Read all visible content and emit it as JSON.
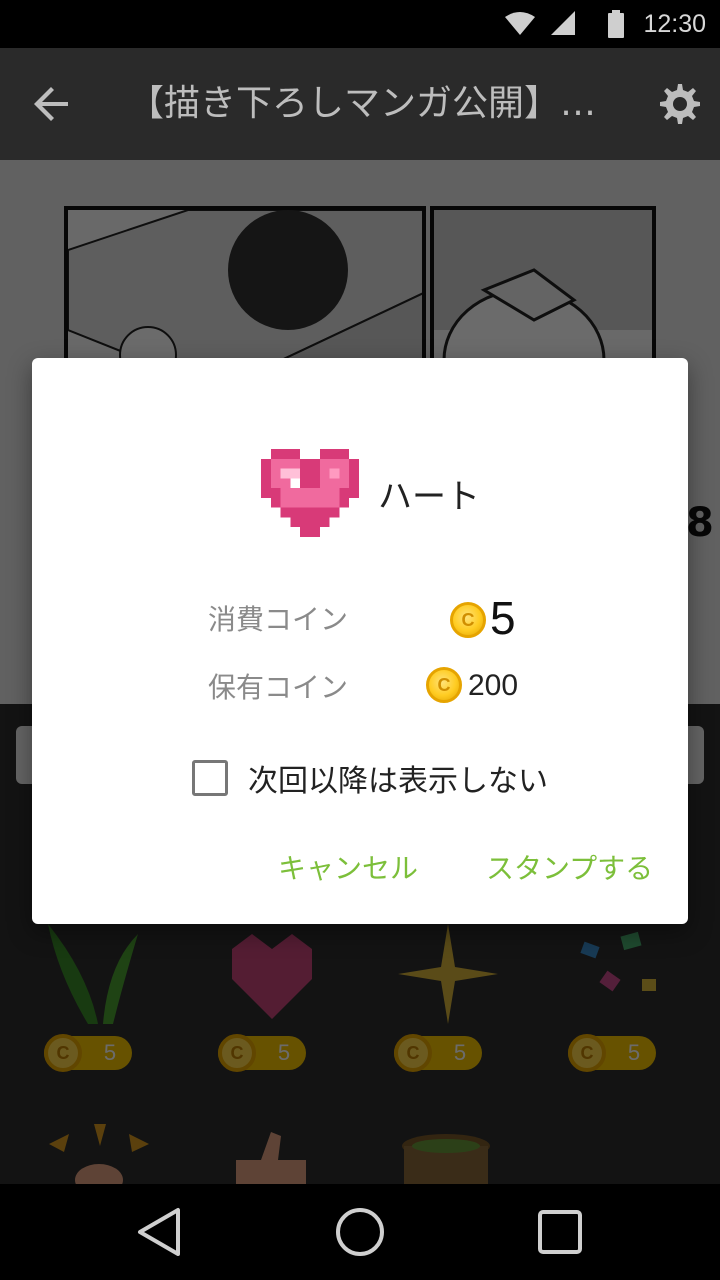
{
  "status_bar": {
    "time": "12:30",
    "icons": [
      "wifi-icon",
      "cell-signal-icon",
      "battery-icon"
    ]
  },
  "toolbar": {
    "title": "【描き下ろしマンガ公開】…",
    "icons": [
      "back-arrow-icon",
      "gear-icon"
    ]
  },
  "background": {
    "page_number": "8",
    "stamps": [
      {
        "name": "grass",
        "price": "5"
      },
      {
        "name": "heart",
        "price": "5"
      },
      {
        "name": "sparkle",
        "price": "5"
      },
      {
        "name": "confetti",
        "price": "5"
      }
    ]
  },
  "dialog": {
    "stamp_name": "ハート",
    "consume_label": "消費コイン",
    "consume_value": "5",
    "owned_label": "保有コイン",
    "owned_value": "200",
    "coin_symbol": "C",
    "checkbox_label": "次回以降は表示しない",
    "checkbox_checked": false,
    "cancel_label": "キャンセル",
    "confirm_label": "スタンプする",
    "accent_color": "#7cbf3a",
    "heart_color": "#e0457e"
  },
  "nav_bar": {
    "icons": [
      "nav-back-icon",
      "nav-home-icon",
      "nav-recent-icon"
    ]
  }
}
